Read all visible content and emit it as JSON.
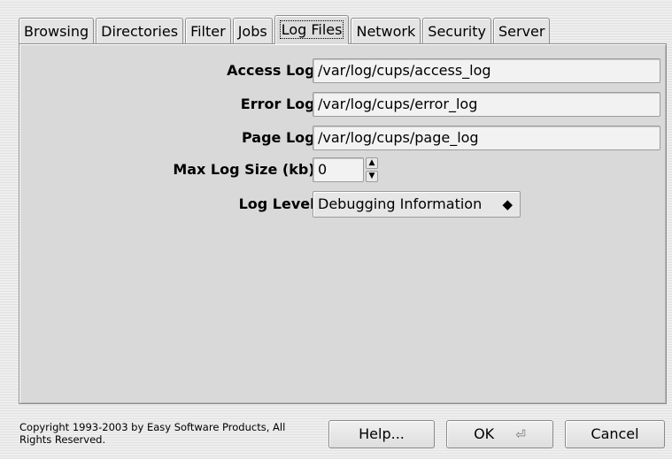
{
  "tabs": [
    {
      "label": "Browsing"
    },
    {
      "label": "Directories"
    },
    {
      "label": "Filter"
    },
    {
      "label": "Jobs"
    },
    {
      "label": "Log Files",
      "active": true
    },
    {
      "label": "Network"
    },
    {
      "label": "Security"
    },
    {
      "label": "Server"
    }
  ],
  "form": {
    "access_log": {
      "label": "Access Log:",
      "value": "/var/log/cups/access_log"
    },
    "error_log": {
      "label": "Error Log:",
      "value": "/var/log/cups/error_log"
    },
    "page_log": {
      "label": "Page Log:",
      "value": "/var/log/cups/page_log"
    },
    "max_log_size": {
      "label": "Max Log Size (kb):",
      "value": "0"
    },
    "log_level": {
      "label": "Log Level:",
      "selected": "Debugging Information"
    }
  },
  "footer": {
    "copyright": "Copyright 1993-2003 by Easy Software Products, All Rights Reserved.",
    "help_label": "Help...",
    "ok_label": "OK",
    "cancel_label": "Cancel"
  },
  "icons": {
    "spinner_up": "triangle-up-icon",
    "spinner_down": "triangle-down-icon",
    "select_arrows": "updown-arrows-icon",
    "return_key": "return-key-icon"
  }
}
